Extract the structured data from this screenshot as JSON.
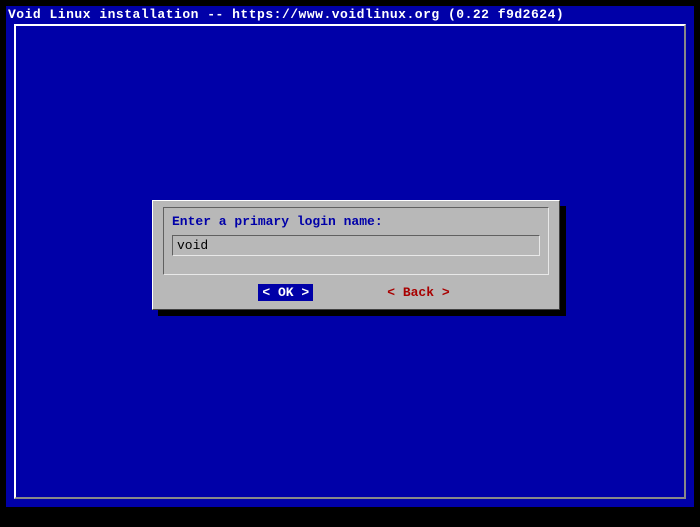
{
  "header": {
    "title": "Void Linux installation -- https://www.voidlinux.org (0.22 f9d2624)"
  },
  "dialog": {
    "prompt": "Enter a primary login name:",
    "input_value": "void",
    "buttons": {
      "ok": {
        "left_bracket": "<",
        "label": " OK ",
        "right_bracket": ">"
      },
      "back": {
        "left_bracket": "<",
        "hotkey": "B",
        "rest": "ack",
        "right_bracket": ">"
      }
    }
  }
}
